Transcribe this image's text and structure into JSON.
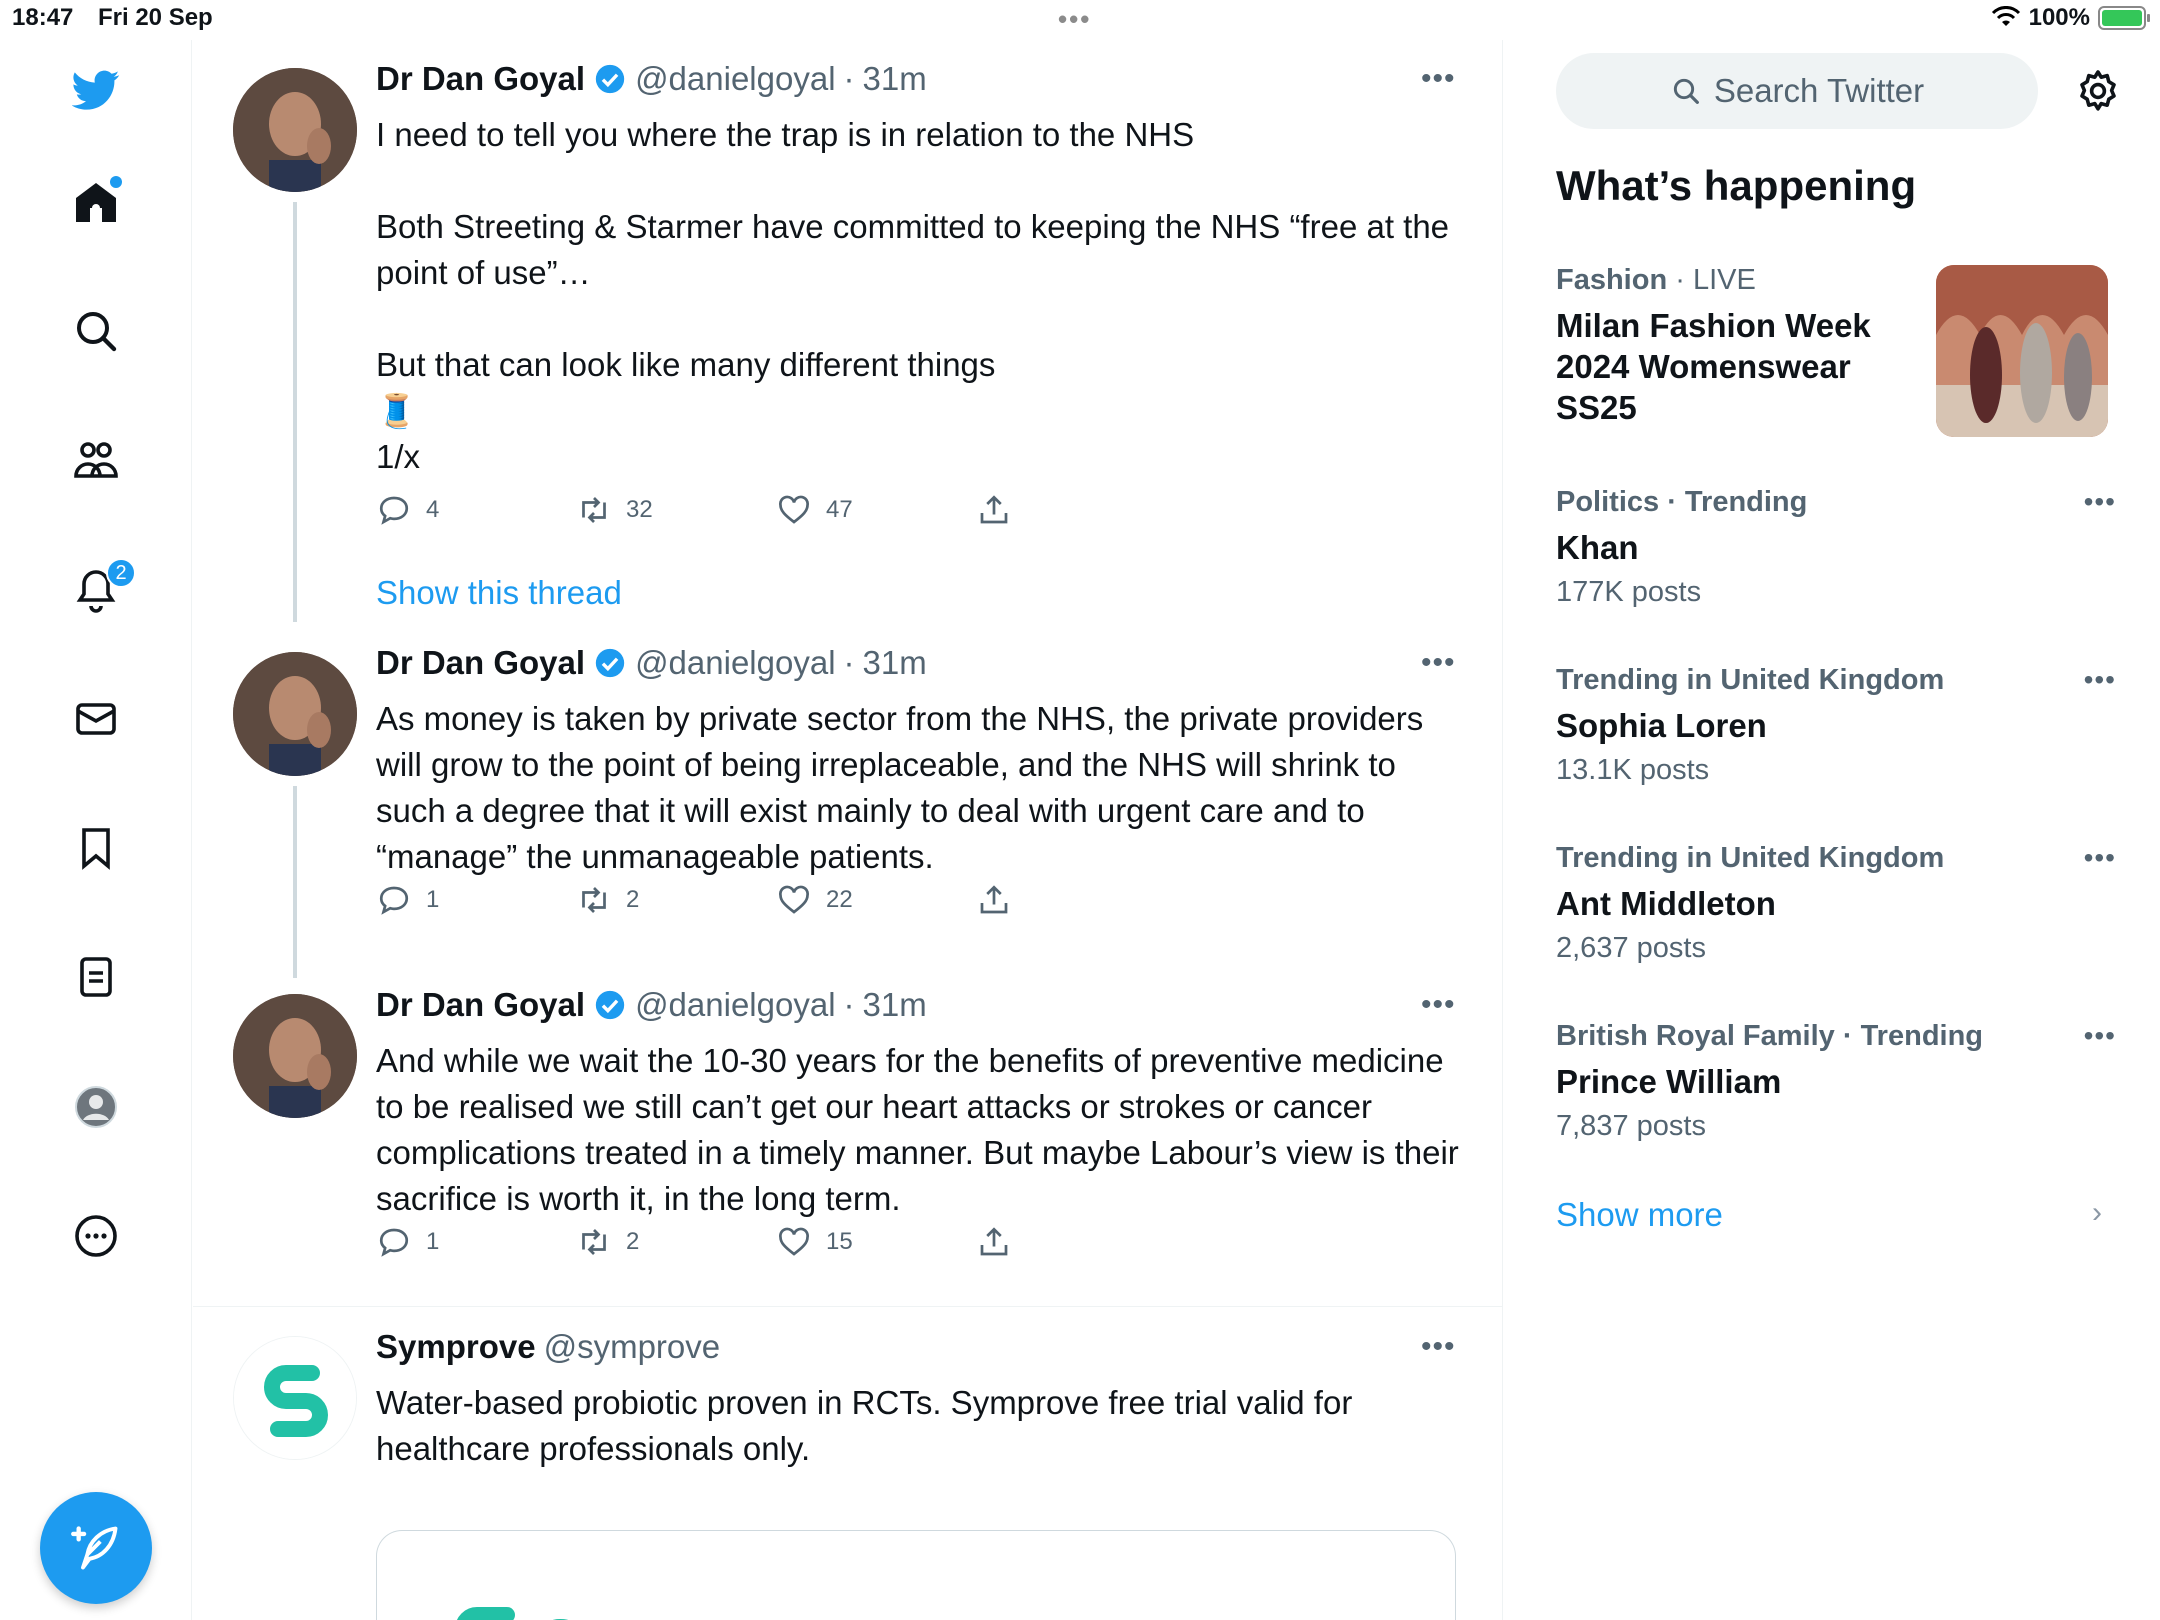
{
  "status_bar": {
    "time": "18:47",
    "date": "Fri 20 Sep",
    "battery": "100%"
  },
  "nav": {
    "notifications_badge": "2"
  },
  "tweets": [
    {
      "name": "Dr Dan Goyal",
      "handle": "@danielgoyal",
      "time": "31m",
      "lines": [
        "I need to tell you where the trap is in relation to the NHS",
        "",
        "Both Streeting & Starmer have committed to keeping the NHS “free at the point of use”…",
        "",
        "But that can look like many different things",
        "🧵",
        "1/x"
      ],
      "replies": "4",
      "retweets": "32",
      "likes": "47"
    },
    {
      "name": "Dr Dan Goyal",
      "handle": "@danielgoyal",
      "time": "31m",
      "text": "As money is taken by private sector from the NHS, the private providers will grow to the point of being irreplaceable, and the NHS will shrink to such a degree that it will exist mainly to deal with urgent care and to “manage” the unmanageable patients.",
      "replies": "1",
      "retweets": "2",
      "likes": "22"
    },
    {
      "name": "Dr Dan Goyal",
      "handle": "@danielgoyal",
      "time": "31m",
      "text": "And while we wait the 10-30 years for the benefits of  preventive medicine to be realised we still can’t get our heart attacks or strokes or cancer complications treated in a timely manner. But maybe Labour’s view is their sacrifice is worth it, in the long term.",
      "replies": "1",
      "retweets": "2",
      "likes": "15"
    }
  ],
  "show_thread": "Show this thread",
  "ad": {
    "name": "Symprove",
    "handle": "@symprove",
    "text": "Water-based probiotic proven in RCTs. Symprove free trial valid for healthcare professionals only.",
    "card_logo_text": "Symprove"
  },
  "sidebar": {
    "search_placeholder": "Search Twitter",
    "heading": "What’s happening",
    "trends": [
      {
        "category": "Fashion",
        "sep": " · ",
        "context": "LIVE",
        "title": "Milan Fashion Week 2024 Womenswear SS25",
        "count": ""
      },
      {
        "category": "Politics · Trending",
        "sep": "",
        "context": "",
        "title": "Khan",
        "count": "177K posts"
      },
      {
        "category": "Trending in United Kingdom",
        "sep": "",
        "context": "",
        "title": "Sophia Loren",
        "count": "13.1K posts"
      },
      {
        "category": "Trending in United Kingdom",
        "sep": "",
        "context": "",
        "title": "Ant Middleton",
        "count": "2,637 posts"
      },
      {
        "category": "British Royal Family · Trending",
        "sep": "",
        "context": "",
        "title": "Prince William",
        "count": "7,837 posts"
      }
    ],
    "show_more": "Show more"
  },
  "colors": {
    "accent": "#1d9bf0",
    "text": "#0f1419",
    "secondary": "#536471",
    "brand_teal": "#22c1a6"
  }
}
